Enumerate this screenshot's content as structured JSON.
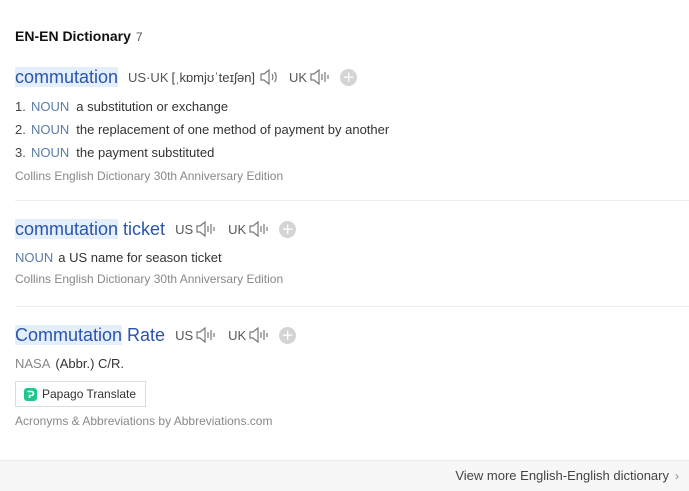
{
  "header": {
    "title": "EN-EN Dictionary",
    "count": "7"
  },
  "entries": [
    {
      "word_highlight": "commutation",
      "word_rest": "",
      "pron_label": "US·UK",
      "ipa": "[ˌkɒmjʊˈteɪʃən]",
      "uk_label": "UK",
      "senses": [
        {
          "num": "1.",
          "pos": "NOUN",
          "def": "a substitution or exchange"
        },
        {
          "num": "2.",
          "pos": "NOUN",
          "def": "the replacement of one method of payment by another"
        },
        {
          "num": "3.",
          "pos": "NOUN",
          "def": "the payment substituted"
        }
      ],
      "source": "Collins English Dictionary 30th Anniversary Edition"
    },
    {
      "word_highlight": "commutation",
      "word_rest": " ticket",
      "us_label": "US",
      "uk_label": "UK",
      "sense": {
        "pos": "NOUN",
        "def": "a US name for season ticket"
      },
      "source": "Collins English Dictionary 30th Anniversary Edition"
    },
    {
      "word_highlight": "Commutation",
      "word_rest": " Rate",
      "us_label": "US",
      "uk_label": "UK",
      "sense": {
        "pos": "NASA",
        "def": "(Abbr.) C/R."
      },
      "translate_button": "Papago Translate",
      "source": "Acronyms & Abbreviations by Abbreviations.com"
    }
  ],
  "footer": {
    "more_label": "View more English-English dictionary",
    "chevron": "›"
  },
  "icons": {
    "speaker": "speaker-icon",
    "plus": "plus-icon",
    "papago": "papago-logo-icon",
    "chevron": "chevron-right-icon"
  },
  "colors": {
    "headword": "#2a54b0",
    "highlight": "#e5effb",
    "pos": "#5a7ea6",
    "papago_green": "#1ec88c"
  }
}
